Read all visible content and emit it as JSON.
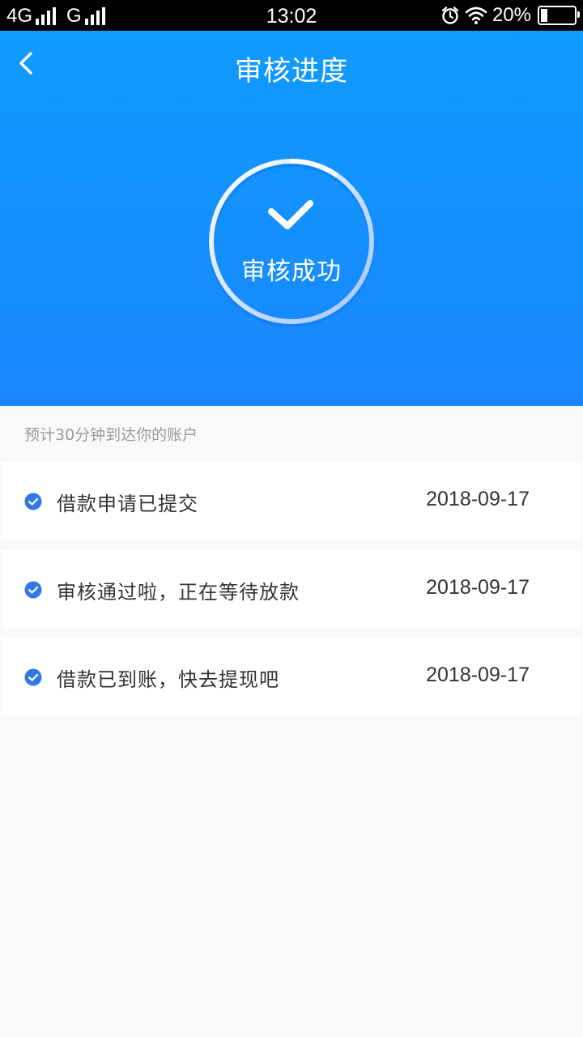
{
  "status_bar": {
    "network_1": "4G",
    "network_2": "G",
    "time": "13:02",
    "battery": "20%",
    "battery_level": 0.2
  },
  "header": {
    "title": "审核进度",
    "back_icon": "chevron-left-icon"
  },
  "status_ring": {
    "label": "审核成功",
    "icon": "check-icon"
  },
  "hint": "预计30分钟到达你的账户",
  "steps": [
    {
      "text": "借款申请已提交",
      "date": "2018-09-17",
      "icon": "check-circle-icon"
    },
    {
      "text": "审核通过啦，正在等待放款",
      "date": "2018-09-17",
      "icon": "check-circle-icon"
    },
    {
      "text": "借款已到账，快去提现吧",
      "date": "2018-09-17",
      "icon": "check-circle-icon"
    }
  ],
  "colors": {
    "primary": "#1a8cff",
    "check_blue": "#3178e6",
    "background": "#f9f9f9"
  }
}
